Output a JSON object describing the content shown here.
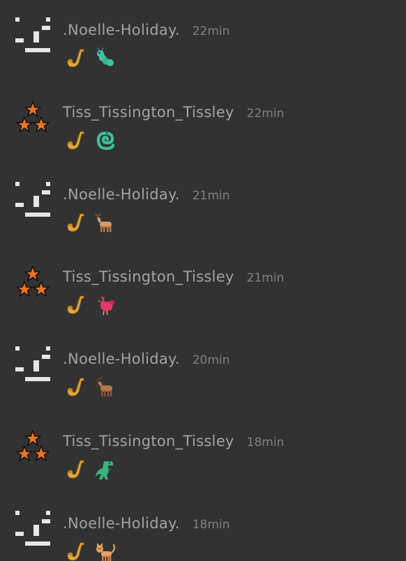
{
  "colors": {
    "background": "#323232",
    "name": "#a3a3a3",
    "time": "#808080",
    "avatar_white": "#e6e6e6",
    "star_orange": "#e8742a"
  },
  "messages": [
    {
      "user": ".Noelle-Holiday.",
      "time": "22min",
      "avatar": "pixel-avatar-icon",
      "emojis": [
        "saxophone-icon",
        "caterpillar-icon"
      ]
    },
    {
      "user": "Tiss_Tissington_Tissley",
      "time": "22min",
      "avatar": "three-stars-avatar-icon",
      "emojis": [
        "saxophone-icon",
        "snake-icon"
      ]
    },
    {
      "user": ".Noelle-Holiday.",
      "time": "21min",
      "avatar": "pixel-avatar-icon",
      "emojis": [
        "saxophone-icon",
        "deer-icon"
      ]
    },
    {
      "user": "Tiss_Tissington_Tissley",
      "time": "21min",
      "avatar": "three-stars-avatar-icon",
      "emojis": [
        "saxophone-icon",
        "rooster-icon"
      ]
    },
    {
      "user": ".Noelle-Holiday.",
      "time": "20min",
      "avatar": "pixel-avatar-icon",
      "emojis": [
        "saxophone-icon",
        "goat-icon"
      ]
    },
    {
      "user": "Tiss_Tissington_Tissley",
      "time": "18min",
      "avatar": "three-stars-avatar-icon",
      "emojis": [
        "saxophone-icon",
        "t-rex-icon"
      ]
    },
    {
      "user": ".Noelle-Holiday.",
      "time": "18min",
      "avatar": "pixel-avatar-icon",
      "emojis": [
        "saxophone-icon",
        "cat-icon"
      ]
    }
  ]
}
